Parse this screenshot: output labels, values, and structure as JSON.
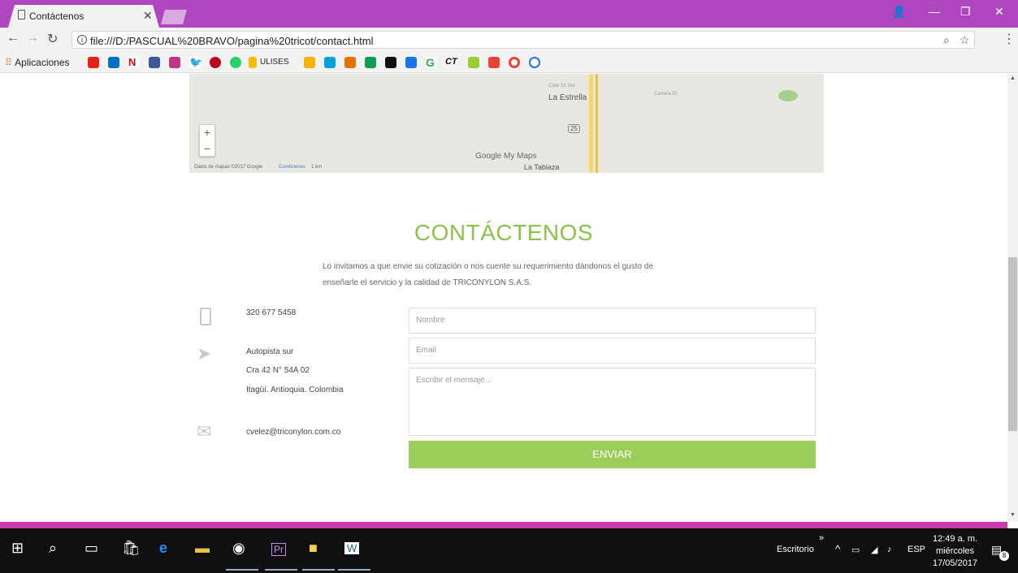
{
  "browser": {
    "tab_title": "Contáctenos",
    "url": "file:///D:/PASCUAL%20BRAVO/pagina%20tricot/contact.html",
    "bookmarks_apps_label": "Aplicaciones",
    "bookmark_ulises": "ULISES",
    "bookmark_ct": "CT"
  },
  "map": {
    "label_estrella": "La Estrella",
    "label_tablaza": "La Tablaza",
    "label_calle": "Calle 81 Sur",
    "label_carrera": "Carrera 50",
    "road_badge": "25",
    "brand": "Google My Maps",
    "attribution": "Datos de mapas ©2017 Google",
    "conditions": "Condiciones",
    "scale": "1 km"
  },
  "contact": {
    "heading": "CONTÁCTENOS",
    "intro": "Lo invitamos a que envie su cotización o nos cuente su requerimiento dándonos el gusto de enseñarle el servicio y la calidad de TRICONYLON S.A.S.",
    "phone": "320 677 5458",
    "address_line1": "Autopista sur",
    "address_line2": "Cra 42 N° 54A 02",
    "address_line3": "Itagüí. Antioquia. Colombia",
    "email": "cvelez@triconylon.com.co"
  },
  "form": {
    "name_placeholder": "Nombre",
    "email_placeholder": "Email",
    "message_placeholder": "Escribir el mensaje...",
    "submit_label": "ENVIAR"
  },
  "taskbar": {
    "desktop_label": "Escritorio",
    "language": "ESP",
    "time": "12:49 a. m.",
    "day": "miércoles",
    "date": "17/05/2017",
    "notifications": "8"
  },
  "colors": {
    "accent_green": "#8bc34a",
    "brand_magenta": "#b045c0"
  }
}
